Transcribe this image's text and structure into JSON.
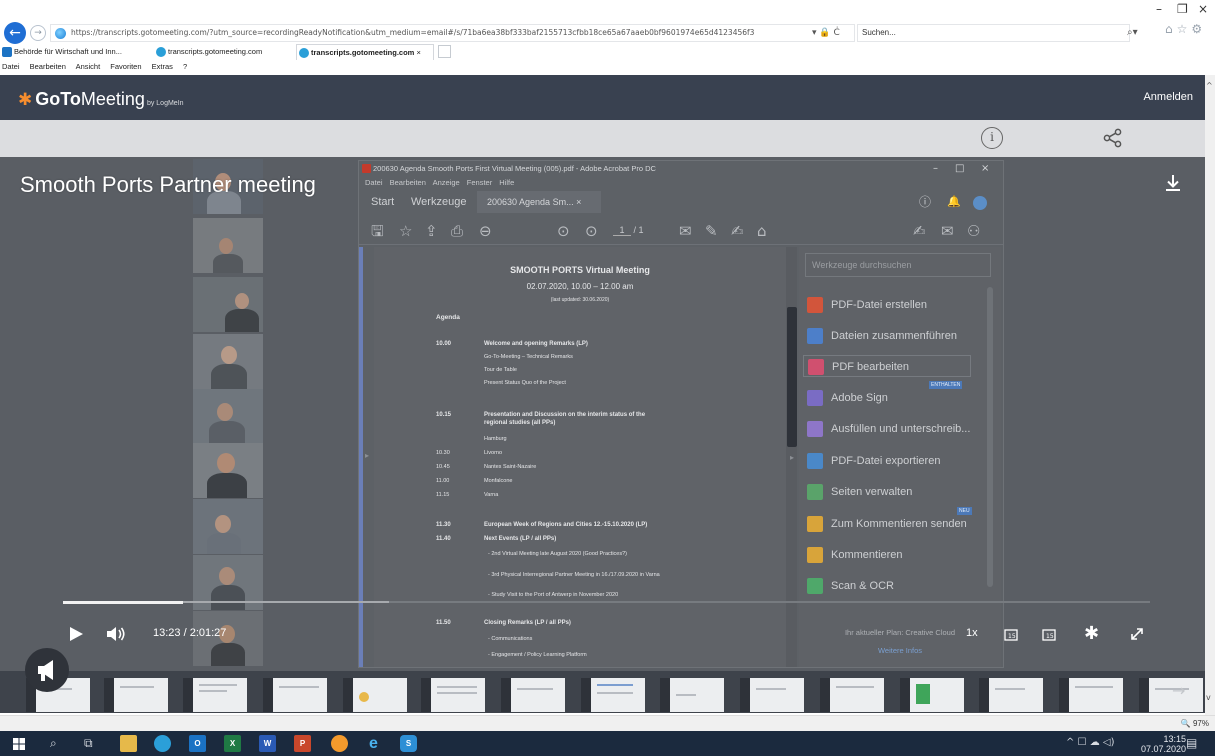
{
  "browser": {
    "url": "https://transcripts.gotomeeting.com/?utm_source=recordingReadyNotification&utm_medium=email#/s/71ba6ea38bf333baf2155713cfbb18ce65a67aaeb0bf9601974e65d4123456f3",
    "addr_right": "▾ 🔒 Ċ",
    "search_placeholder": "Suchen...",
    "tabs": [
      {
        "label": "Behörde für Wirtschaft und Inn...",
        "color": "#1c73c4"
      },
      {
        "label": "transcripts.gotomeeting.com",
        "color": "#2a9fd8"
      },
      {
        "label": "transcripts.gotomeeting.com",
        "color": "#2a9fd8",
        "close": "×"
      }
    ],
    "menu": [
      "Datei",
      "Bearbeiten",
      "Ansicht",
      "Favoriten",
      "Extras",
      "?"
    ],
    "zoom": "🔍 97%"
  },
  "app": {
    "logo_bold": "GoTo",
    "logo_thin": "Meeting",
    "logo_by": "by LogMeIn",
    "sign_in": "Anmelden"
  },
  "video": {
    "title": "Smooth Ports Partner meeting",
    "time": "13:23 / 2:01:27",
    "speed": "1x",
    "progress": {
      "played_fraction": 0.11,
      "buffered_fraction": 0.3
    }
  },
  "acrobat": {
    "window_title": "200630 Agenda Smooth Ports First Virtual Meeting (005).pdf - Adobe Acrobat Pro DC",
    "menu": [
      "Datei",
      "Bearbeiten",
      "Anzeige",
      "Fenster",
      "Hilfe"
    ],
    "tab_start": "Start",
    "tab_tools": "Werkzeuge",
    "doc_tab": "200630 Agenda Sm... ×",
    "page": "1",
    "page_total": "/ 1",
    "tools_search": "Werkzeuge durchsuchen",
    "tools": [
      {
        "label": "PDF-Datei erstellen",
        "color": "#d2553b"
      },
      {
        "label": "Dateien zusammenführen",
        "color": "#4d7fc9"
      },
      {
        "label": "PDF bearbeiten",
        "color": "#d0506f"
      },
      {
        "label": "Adobe Sign",
        "color": "#7a6cc4"
      },
      {
        "label": "Ausfüllen und unterschreib...",
        "color": "#8e76c8"
      },
      {
        "label": "PDF-Datei exportieren",
        "color": "#4a88c8"
      },
      {
        "label": "Seiten verwalten",
        "color": "#5aa36a"
      },
      {
        "label": "Zum Kommentieren senden",
        "color": "#d8a43a"
      },
      {
        "label": "Kommentieren",
        "color": "#d8a43a"
      },
      {
        "label": "Scan & OCR",
        "color": "#4fa86a"
      }
    ],
    "badge_included": "ENTHALTEN",
    "badge_new": "NEU",
    "plan_text": "Ihr aktueller Plan: Creative Cloud",
    "more_info": "Weitere Infos"
  },
  "agenda": {
    "title": "SMOOTH PORTS Virtual Meeting",
    "date": "02.07.2020, 10.00 – 12.00 am",
    "updated": "(last updated: 30.06.2020)",
    "label": "Agenda",
    "t1000": "10.00",
    "welcome": "Welcome and opening Remarks (LP)",
    "gtm": "Go-To-Meeting – Technical Remarks",
    "tour": "Tour de Table",
    "status": "Present Status Quo of the Project",
    "t1015": "10.15",
    "pres1": "Presentation and Discussion on the interim status of the",
    "pres2": "regional studies (all PPs)",
    "hamburg": "Hamburg",
    "t1030": "10.30",
    "livorno": "Livorno",
    "t1045": "10.45",
    "nantes": "Nantes Saint-Nazaire",
    "t1100": "11.00",
    "monfalcone": "Monfalcone",
    "t1115": "11.15",
    "varna": "Varna",
    "t1130": "11.30",
    "week": "European Week of Regions and Cities 12.-15.10.2020 (LP)",
    "t1140": "11.40",
    "next": "Next Events (LP / all PPs)",
    "ev1": "-   2nd Virtual Meeting late August 2020 (Good Practices?)",
    "ev2": "-   3rd Physical Interregional Partner Meeting in 16./17.09.2020 in Varna",
    "ev3": "-   Study Visit to the Port of Antwerp in November 2020",
    "t1150": "11.50",
    "closing": "Closing Remarks (LP / all PPs)",
    "comm": "-       Communications",
    "engage": "-       Engagement / Policy Learning Platform"
  },
  "taskbar": {
    "time": "13:15",
    "date": "07.07.2020"
  },
  "colors": {
    "header": "#394150",
    "video_bg": "#5a5e64",
    "accent": "#f68d2e",
    "taskbar": "#1b2a3e"
  }
}
